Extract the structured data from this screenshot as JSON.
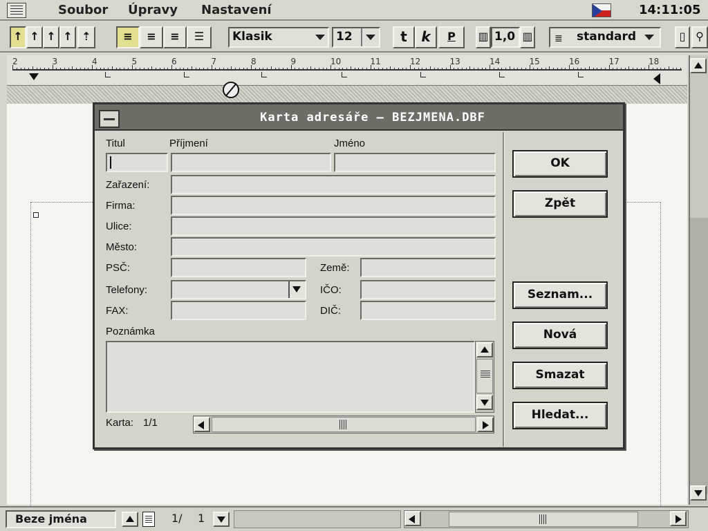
{
  "menubar": {
    "items": [
      {
        "label": "Soubor",
        "accel": "S"
      },
      {
        "label": "Úpravy",
        "accel": "Ú"
      },
      {
        "label": "Nastavení",
        "accel": "N"
      }
    ],
    "clock": "14:11:05"
  },
  "toolbar": {
    "font": "Klasik",
    "size": "12",
    "bold": "t",
    "italic": "k",
    "underline": "P",
    "spacing": "1,0",
    "style": "standard"
  },
  "ruler": {
    "numbers": [
      "2",
      "3",
      "4",
      "5",
      "6",
      "7",
      "8",
      "9",
      "10",
      "11",
      "12",
      "13",
      "14",
      "15",
      "16",
      "17",
      "18"
    ]
  },
  "dialog": {
    "title": "Karta adresáře – BEZJMENA.DBF",
    "labels": {
      "titul": "Titul",
      "prijmeni": "Příjmení",
      "jmeno": "Jméno",
      "zarazeni": "Zařazení:",
      "firma": "Firma:",
      "ulice": "Ulice:",
      "mesto": "Město:",
      "psc": "PSČ:",
      "zeme": "Země:",
      "telefony": "Telefony:",
      "ico": "IČO:",
      "fax": "FAX:",
      "dic": "DIČ:",
      "poznamka": "Poznámka",
      "karta": "Karta:",
      "karta_value": "1/1"
    },
    "buttons": {
      "ok": "OK",
      "zpet": "Zpět",
      "seznam": "Seznam...",
      "nova": "Nová",
      "smazat": "Smazat",
      "hledat": "Hledat..."
    }
  },
  "statusbar": {
    "doc_name": "Beze jména",
    "page_current": "1/",
    "page_total": "1"
  }
}
